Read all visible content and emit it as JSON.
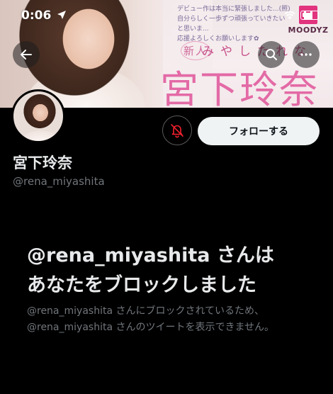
{
  "status_bar": {
    "time": "0:06"
  },
  "banner": {
    "note_lines": [
      "デビュー作は本当に緊張しました...(照)",
      "自分らしく一歩ずつ頑張っていきたいと思いま...",
      "応援よろしくお願いします✿"
    ],
    "kicker": "新人",
    "kana": "みやしたれな",
    "name": "宮下玲奈",
    "logo_text": "MOODYZ"
  },
  "profile": {
    "display_name": "宮下玲奈",
    "handle": "@rena_miyashita",
    "follow_label": "フォローする"
  },
  "blocked": {
    "title_line1": "@rena_miyashita さんは",
    "title_line2": "あなたをブロックしました",
    "body_line1": "@rena_miyashita さんにブロックされているため、",
    "body_line2": "@rena_miyashita さんのツイートを表示できません。"
  },
  "colors": {
    "background": "#000000",
    "primary_text": "#e7e9ea",
    "secondary_text": "#71767b",
    "follow_button_bg": "#eff3f4",
    "mute_icon": "#f4212e",
    "banner_name": "#e36aa6"
  },
  "icons": {
    "location": "location-arrow-icon",
    "wifi": "wifi-icon",
    "battery": "battery-icon",
    "back": "back-arrow-icon",
    "search": "search-icon",
    "more": "more-horizontal-icon",
    "mute": "bell-muted-icon"
  }
}
